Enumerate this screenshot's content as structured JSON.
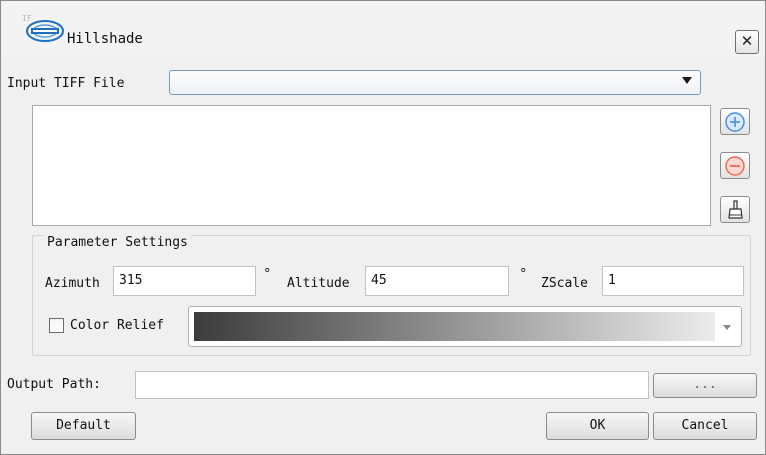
{
  "window": {
    "title": "Hillshade",
    "close_label": "✕"
  },
  "input": {
    "label": "Input TIFF File",
    "selected": ""
  },
  "parameters": {
    "group_title": "Parameter Settings",
    "azimuth_label": "Azimuth",
    "azimuth_value": "315",
    "altitude_label": "Altitude",
    "altitude_value": "45",
    "zscale_label": "ZScale",
    "zscale_value": "1",
    "degree_symbol": "°",
    "color_relief_label": "Color Relief",
    "color_relief_checked": false,
    "ramp_colors": [
      "#3c3c3c",
      "#ececec"
    ]
  },
  "output": {
    "label": "Output Path:",
    "value": "",
    "browse_label": "..."
  },
  "buttons": {
    "default_label": "Default",
    "ok_label": "OK",
    "cancel_label": "Cancel"
  },
  "icons": [
    "app-logo-icon",
    "add-icon",
    "remove-icon",
    "clear-brush-icon",
    "dropdown-arrow-icon"
  ],
  "colors": {
    "add_icon": "#4a8ee0",
    "remove_icon": "#ef6a5a"
  }
}
